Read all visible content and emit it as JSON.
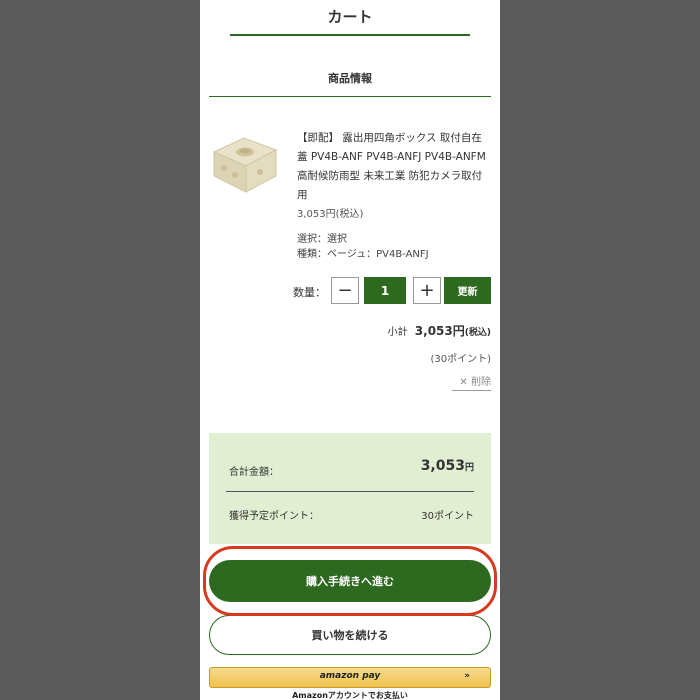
{
  "header": {
    "title": "カート"
  },
  "section": {
    "title": "商品情報"
  },
  "item": {
    "name": "【即配】 露出用四角ボックス 取付自在蓋 PV4B-ANF PV4B-ANFJ PV4B-ANFM 高耐候防雨型 未来工業 防犯カメラ取付用",
    "price": "3,053円(税込)",
    "option1": "選択：選択",
    "option2": "種類：ベージュ：PV4B-ANFJ",
    "qty_label": "数量：",
    "qty_minus": "−",
    "qty_value": "1",
    "qty_plus": "+",
    "update_label": "更新",
    "subtotal_label": "小計",
    "subtotal_amount": "3,053円",
    "subtotal_tax": "(税込)",
    "points_note": "(30ポイント)",
    "delete_label": "削除"
  },
  "summary": {
    "total_label": "合計金額：",
    "total_amount": "3,053",
    "total_yen": "円",
    "points_label": "獲得予定ポイント：",
    "points_value": "30ポイント"
  },
  "actions": {
    "checkout_label": "購入手続きへ進む",
    "continue_label": "買い物を続ける",
    "amazon_logo": "amazon pay",
    "amazon_arrows": "»",
    "amazon_caption": "Amazonアカウントでお支払い"
  },
  "colors": {
    "accent": "#2d6a1f",
    "summary_bg": "#e1eed2",
    "highlight": "#d93a1e",
    "amazon": "#efc14f"
  }
}
